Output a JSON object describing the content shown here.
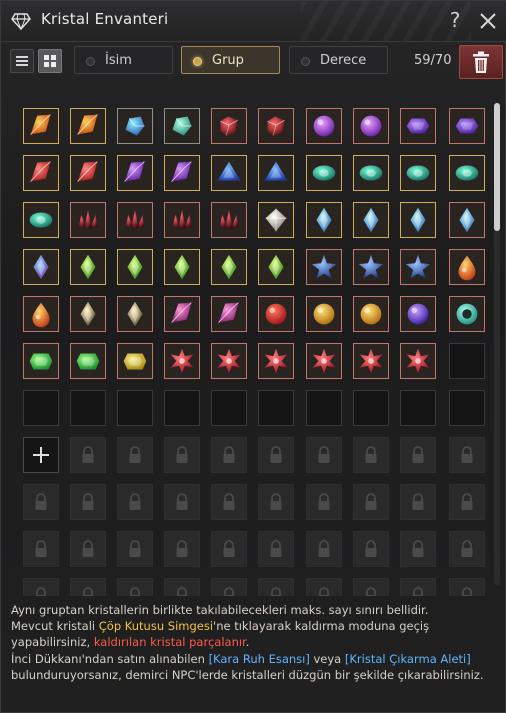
{
  "window": {
    "title": "Kristal Envanteri"
  },
  "toolbar": {
    "sort_options": [
      {
        "label": "İsim",
        "active": false
      },
      {
        "label": "Grup",
        "active": true
      },
      {
        "label": "Derece",
        "active": false
      }
    ],
    "count": "59/70"
  },
  "colors": {
    "accent_gold": "#c9a24e",
    "trash_red": "#7d3434",
    "highlight_gold": "#f2c24b",
    "highlight_red": "#ff5b4a",
    "highlight_blue": "#5fb6ff"
  },
  "crystals": [
    [
      "orange-flame",
      "orange-flame",
      "blue-green-chunk",
      "teal-chunk",
      "red-cube",
      "red-cube",
      "purple-orb",
      "purple-orb",
      "violet-hex",
      "violet-hex"
    ],
    [
      "red-shard",
      "red-shard",
      "purple-shard",
      "purple-shard",
      "blue-triangle",
      "blue-triangle",
      "teal-eye",
      "teal-eye",
      "teal-eye",
      "teal-eye"
    ],
    [
      "teal-eye",
      "dark-red-cluster",
      "dark-red-cluster",
      "dark-red-cluster",
      "dark-red-cluster",
      "white-diamond",
      "ice-spike",
      "ice-spike",
      "ice-spike",
      "none"
    ],
    [
      "blue-spike",
      "green-spike",
      "green-spike",
      "green-spike",
      "green-spike",
      "green-spike",
      "blue-star",
      "blue-star",
      "blue-star",
      "orange-drop"
    ],
    [
      "orange-drop",
      "gold-spike",
      "gold-spike",
      "pink-shard",
      "pink-shard",
      "red-sphere",
      "gold-sphere",
      "gold-sphere",
      "violet-ball",
      "teal-ring"
    ],
    [
      "green-gem",
      "green-gem",
      "gold-gem",
      "red-star",
      "red-star",
      "red-star",
      "red-star",
      "red-star",
      "red-star",
      "empty"
    ],
    [
      "empty",
      "empty",
      "empty",
      "empty",
      "empty",
      "empty",
      "empty",
      "empty",
      "empty",
      "empty"
    ]
  ],
  "description": {
    "p1": "Aynı gruptan kristallerin birlikte takılabilecekleri maks. sayı sınırı bellidir.",
    "p2a": "Mevcut kristali ",
    "p2b": "Çöp Kutusu Simgesi",
    "p2c": "'ne tıklayarak kaldırma moduna geçiş yapabilirsiniz, ",
    "p2d": "kaldırılan kristal parçalanır",
    "p2e": ".",
    "p3a": "İnci Dükkanı'ndan satın alınabilen ",
    "p3b": "[Kara Ruh Esansı]",
    "p3c": " veya ",
    "p3d": "[Kristal Çıkarma Aleti]",
    "p3e": " bulunduruyorsanız, demirci NPC'lerde kristalleri düzgün bir şekilde çıkarabilirsiniz."
  }
}
